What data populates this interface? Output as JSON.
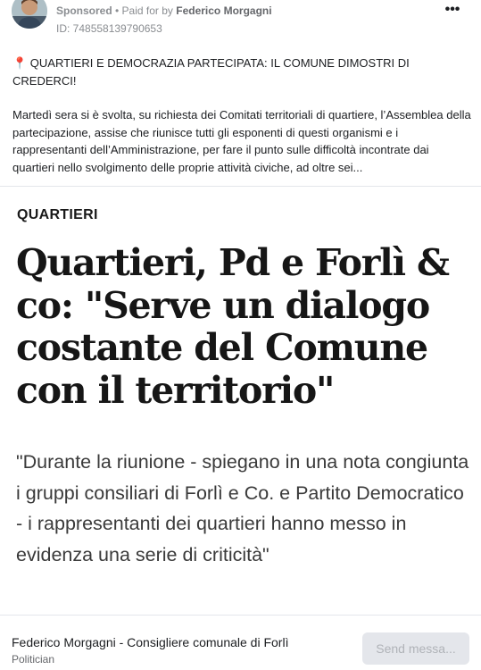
{
  "ad": {
    "sponsored_label": "Sponsored",
    "paid_for_prefix": " • Paid for by ",
    "advertiser_name": "Federico Morgagni",
    "library_id": "ID: 748558139790653",
    "more_icon": "•••"
  },
  "post": {
    "pin_icon": "📍",
    "title": " QUARTIERI E DEMOCRAZIA PARTECIPATA: IL COMUNE DIMOSTRI DI CREDERCI!",
    "paragraph": "Martedì sera si è svolta, su richiesta dei Comitati territoriali di quartiere, l’Assemblea della partecipazione, assise che riunisce tutti gli esponenti di questi organismi e i rappresentanti dell’Amministrazione, per fare il punto sulle difficoltà incontrate dai quartieri nello svolgimento delle proprie attività civiche, ad oltre sei..."
  },
  "article": {
    "section": "QUARTIERI",
    "headline": "Quartieri, Pd e Forlì & co: \"Serve un dialogo costante del Comune con il territorio\"",
    "quote": "\"Durante la riunione - spiegano in una nota congiunta i gruppi consiliari di Forlì e Co.  e Partito Democratico - i rappresentanti dei quartieri hanno messo in evidenza una serie di criticità\""
  },
  "footer": {
    "page_name": "Federico Morgagni - Consigliere comunale di Forlì",
    "page_category": "Politician",
    "cta_label": "Send messa..."
  },
  "colors": {
    "pin": "#e2266b",
    "button_bg": "#e4e6eb"
  }
}
